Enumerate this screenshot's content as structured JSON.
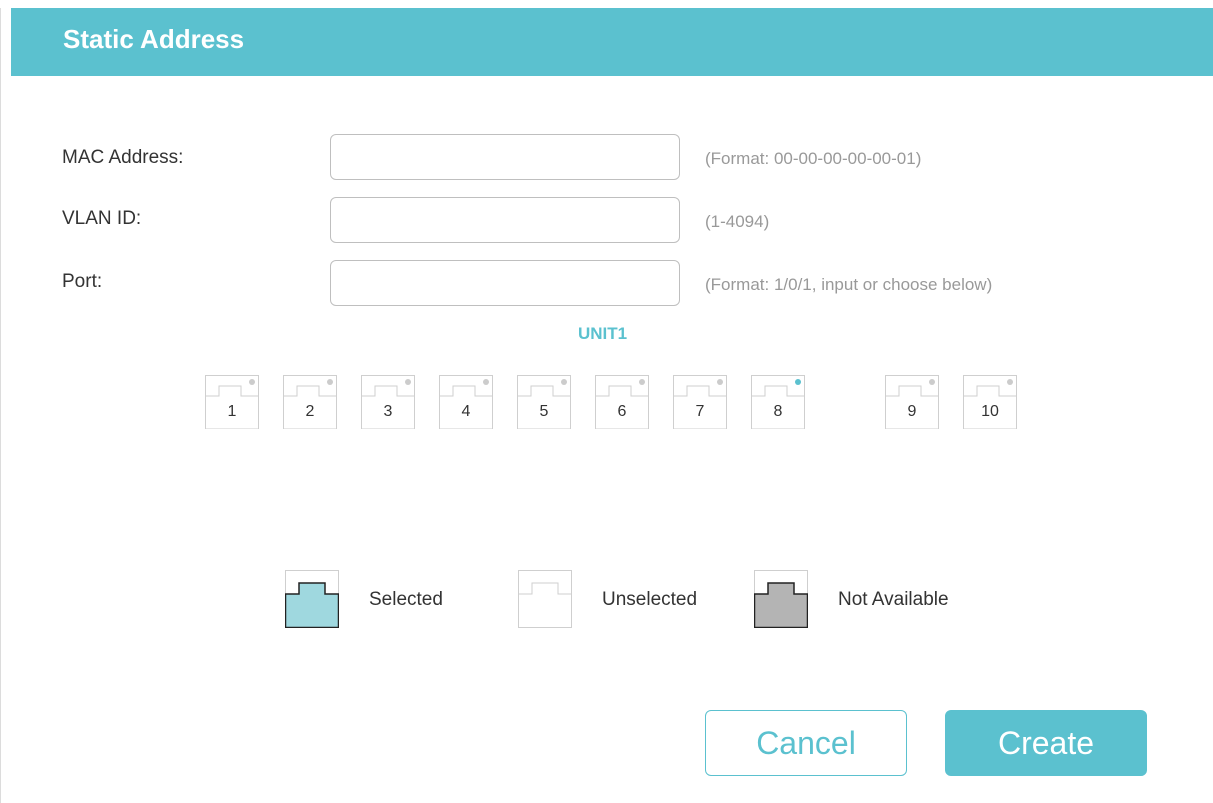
{
  "title": "Static Address",
  "form": {
    "mac": {
      "label": "MAC Address:",
      "value": "",
      "hint": "(Format: 00-00-00-00-00-01)"
    },
    "vlan": {
      "label": "VLAN ID:",
      "value": "",
      "hint": "(1-4094)"
    },
    "port": {
      "label": "Port:",
      "value": "",
      "hint": "(Format: 1/0/1, input or choose below)"
    }
  },
  "unit": "UNIT1",
  "ports": [
    {
      "label": "1",
      "status": "unselected",
      "link": false
    },
    {
      "label": "2",
      "status": "unselected",
      "link": false
    },
    {
      "label": "3",
      "status": "unselected",
      "link": false
    },
    {
      "label": "4",
      "status": "unselected",
      "link": false
    },
    {
      "label": "5",
      "status": "unselected",
      "link": false
    },
    {
      "label": "6",
      "status": "unselected",
      "link": false
    },
    {
      "label": "7",
      "status": "unselected",
      "link": false
    },
    {
      "label": "8",
      "status": "unselected",
      "link": true
    },
    {
      "label": "9",
      "status": "unselected",
      "link": false
    },
    {
      "label": "10",
      "status": "unselected",
      "link": false
    }
  ],
  "legend": {
    "selected": "Selected",
    "unselected": "Unselected",
    "not_available": "Not Available"
  },
  "buttons": {
    "cancel": "Cancel",
    "create": "Create"
  },
  "colors": {
    "accent": "#5bc1cf",
    "selected_fill": "#9fd8df",
    "not_available_fill": "#b4b4b4",
    "link_active": "#5bc1cf",
    "link_inactive": "#cccccc"
  }
}
